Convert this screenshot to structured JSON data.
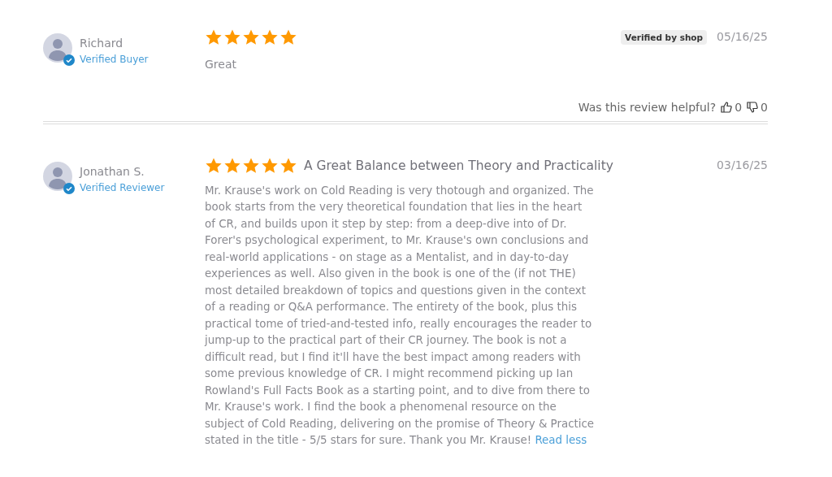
{
  "reviews": [
    {
      "author": "Richard",
      "author_badge": "Verified Buyer",
      "stars": 5,
      "shop_badge": "Verified by **shop**",
      "date": "05/16/25",
      "body": "Great",
      "helpful": {
        "question": "Was this review helpful?",
        "up": "0",
        "down": "0"
      }
    },
    {
      "author": "Jonathan S.",
      "author_badge": "Verified Reviewer",
      "stars": 5,
      "title": "A Great Balance between Theory and Practicality",
      "date": "03/16/25",
      "body": "Mr. Krause's work on Cold Reading is very thotough and organized. The book starts from the very theoretical foundation that lies in the heart of CR, and builds upon it step by step: from a deep-dive into of Dr. Forer's psychological experiment, to Mr. Krause's own conclusions and real-world applications - on stage as a Mentalist, and in day-to-day experiences as well. Also given in the book is one of the (if not THE) most detailed breakdown of topics and questions given in the context of a reading or Q&A performance. The entirety of the book, plus this practical tome of tried-and-tested info, really encourages the reader to jump-up to the practical part of their CR journey. The book is not a difficult read, but I find it'll have the best impact among readers with some previous knowledge of CR. I might recommend picking up Ian Rowland's Full Facts Book as a starting point, and to dive from there to Mr. Krause's work. I find the book a phenomenal resource on the subject of Cold Reading, delivering on the promise of Theory & Practice stated in the title - 5/5 stars for sure. Thank you Mr. Krause!",
      "toggle_link": "Read less"
    }
  ]
}
